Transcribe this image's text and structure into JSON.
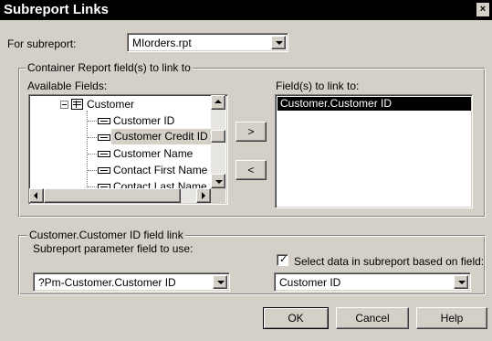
{
  "window": {
    "title": "Subreport Links",
    "close_glyph": "×"
  },
  "subreport": {
    "label": "For subreport:",
    "value": "MIorders.rpt"
  },
  "container_group": {
    "legend": "Container Report field(s) to link to",
    "available_label": "Available Fields:",
    "tree": {
      "parent": "Customer",
      "items": [
        {
          "label": "Customer ID"
        },
        {
          "label": "Customer Credit ID",
          "selected": true
        },
        {
          "label": "Customer Name"
        },
        {
          "label": "Contact First Name"
        },
        {
          "label": "Contact Last Name"
        }
      ]
    },
    "add_button": ">",
    "remove_button": "<",
    "linked_label": "Field(s) to link to:",
    "linked_items": [
      "Customer.Customer ID"
    ]
  },
  "link_group": {
    "legend": "Customer.Customer ID field link",
    "param_label": "Subreport parameter field to use:",
    "param_value": "?Pm-Customer.Customer ID",
    "select_data_label": "Select data in subreport based on field:",
    "select_data_checked": true,
    "field_value": "Customer ID"
  },
  "buttons": {
    "ok": "OK",
    "cancel": "Cancel",
    "help": "Help"
  },
  "colors": {
    "dialog_bg": "#d4d0c8",
    "title_bg": "#000000",
    "selection_bg": "#000000",
    "selection_text": "#ffffff"
  }
}
